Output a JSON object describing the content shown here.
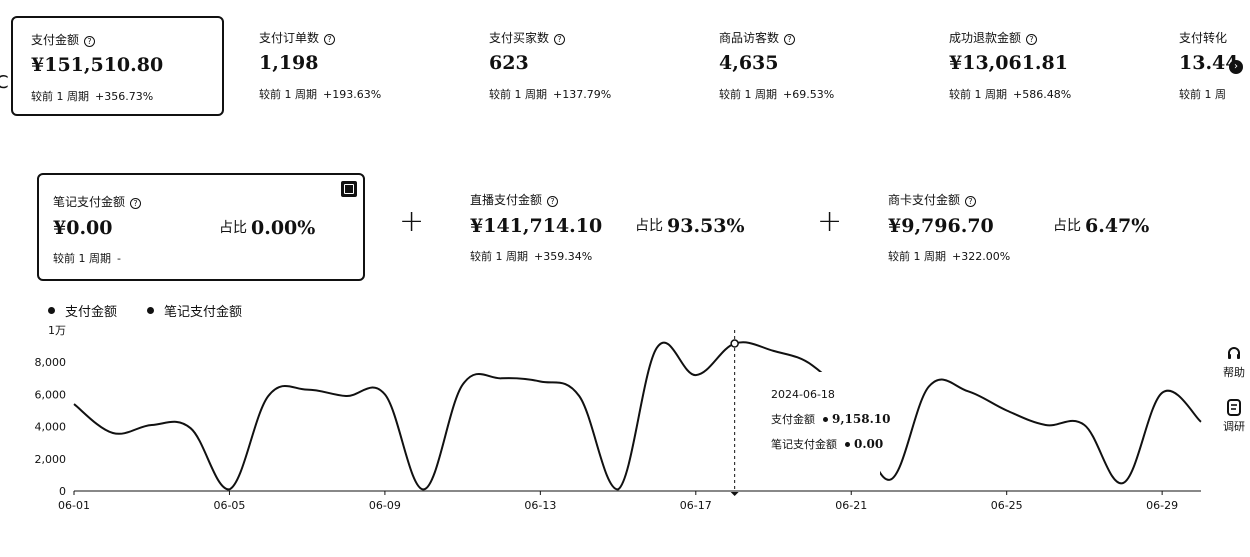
{
  "metrics": [
    {
      "label": "支付金额",
      "value": "¥151,510.80",
      "compare_label": "较前 1 周期",
      "delta": "+356.73%",
      "selected": true
    },
    {
      "label": "支付订单数",
      "value": "1,198",
      "compare_label": "较前 1 周期",
      "delta": "+193.63%"
    },
    {
      "label": "支付买家数",
      "value": "623",
      "compare_label": "较前 1 周期",
      "delta": "+137.79%"
    },
    {
      "label": "商品访客数",
      "value": "4,635",
      "compare_label": "较前 1 周期",
      "delta": "+69.53%"
    },
    {
      "label": "成功退款金额",
      "value": "¥13,061.81",
      "compare_label": "较前 1 周期",
      "delta": "+586.48%"
    },
    {
      "label": "支付转化",
      "value": "13.44",
      "compare_label": "较前 1 周",
      "delta": ""
    }
  ],
  "left_edge_glyph": "C",
  "help_glyph": "?",
  "next_glyph": "›",
  "channels": [
    {
      "label": "笔记支付金额",
      "value": "¥0.00",
      "share_label": "占比",
      "share": "0.00%",
      "compare_label": "较前 1 周期",
      "delta": "-",
      "selected": true
    },
    {
      "label": "直播支付金额",
      "value": "¥141,714.10",
      "share_label": "占比",
      "share": "93.53%",
      "compare_label": "较前 1 周期",
      "delta": "+359.34%"
    },
    {
      "label": "商卡支付金额",
      "value": "¥9,796.70",
      "share_label": "占比",
      "share": "6.47%",
      "compare_label": "较前 1 周期",
      "delta": "+322.00%"
    }
  ],
  "plus_sign": "+",
  "legend": [
    "支付金额",
    "笔记支付金额"
  ],
  "chart_data": {
    "type": "line",
    "y_unit_label": "1万",
    "y_ticks": [
      0,
      2000,
      4000,
      6000,
      8000
    ],
    "y_tick_labels": [
      "0",
      "2,000",
      "4,000",
      "6,000",
      "8,000"
    ],
    "ylim": [
      0,
      10000
    ],
    "x_tick_labels": [
      "06-01",
      "06-05",
      "06-09",
      "06-13",
      "06-17",
      "06-21",
      "06-25",
      "06-29"
    ],
    "x": [
      "06-01",
      "06-02",
      "06-03",
      "06-04",
      "06-05",
      "06-06",
      "06-07",
      "06-08",
      "06-09",
      "06-10",
      "06-11",
      "06-12",
      "06-13",
      "06-14",
      "06-15",
      "06-16",
      "06-17",
      "06-18",
      "06-19",
      "06-20",
      "06-21",
      "06-22",
      "06-23",
      "06-24",
      "06-25",
      "06-26",
      "06-27",
      "06-28",
      "06-29",
      "06-30"
    ],
    "series": [
      {
        "name": "支付金额",
        "values": [
          5400,
          3600,
          4100,
          3900,
          100,
          5900,
          6300,
          5900,
          6000,
          100,
          6600,
          7000,
          6800,
          5900,
          100,
          8900,
          7200,
          9158.1,
          8700,
          7800,
          5200,
          700,
          6500,
          6200,
          5000,
          4100,
          4100,
          500,
          6100,
          4300
        ]
      },
      {
        "name": "笔记支付金额",
        "values": [
          0,
          0,
          0,
          0,
          0,
          0,
          0,
          0,
          0,
          0,
          0,
          0,
          0,
          0,
          0,
          0,
          0,
          0,
          0,
          0,
          0,
          0,
          0,
          0,
          0,
          0,
          0,
          0,
          0,
          0
        ]
      }
    ],
    "grid": false,
    "legend_position": "top-left"
  },
  "tooltip": {
    "date": "2024-06-18",
    "rows": [
      {
        "label": "支付金额",
        "value": "9,158.10"
      },
      {
        "label": "笔记支付金额",
        "value": "0.00"
      }
    ]
  },
  "side_tools": [
    {
      "label": "帮助",
      "icon": "headset-icon"
    },
    {
      "label": "调研",
      "icon": "survey-icon"
    }
  ]
}
